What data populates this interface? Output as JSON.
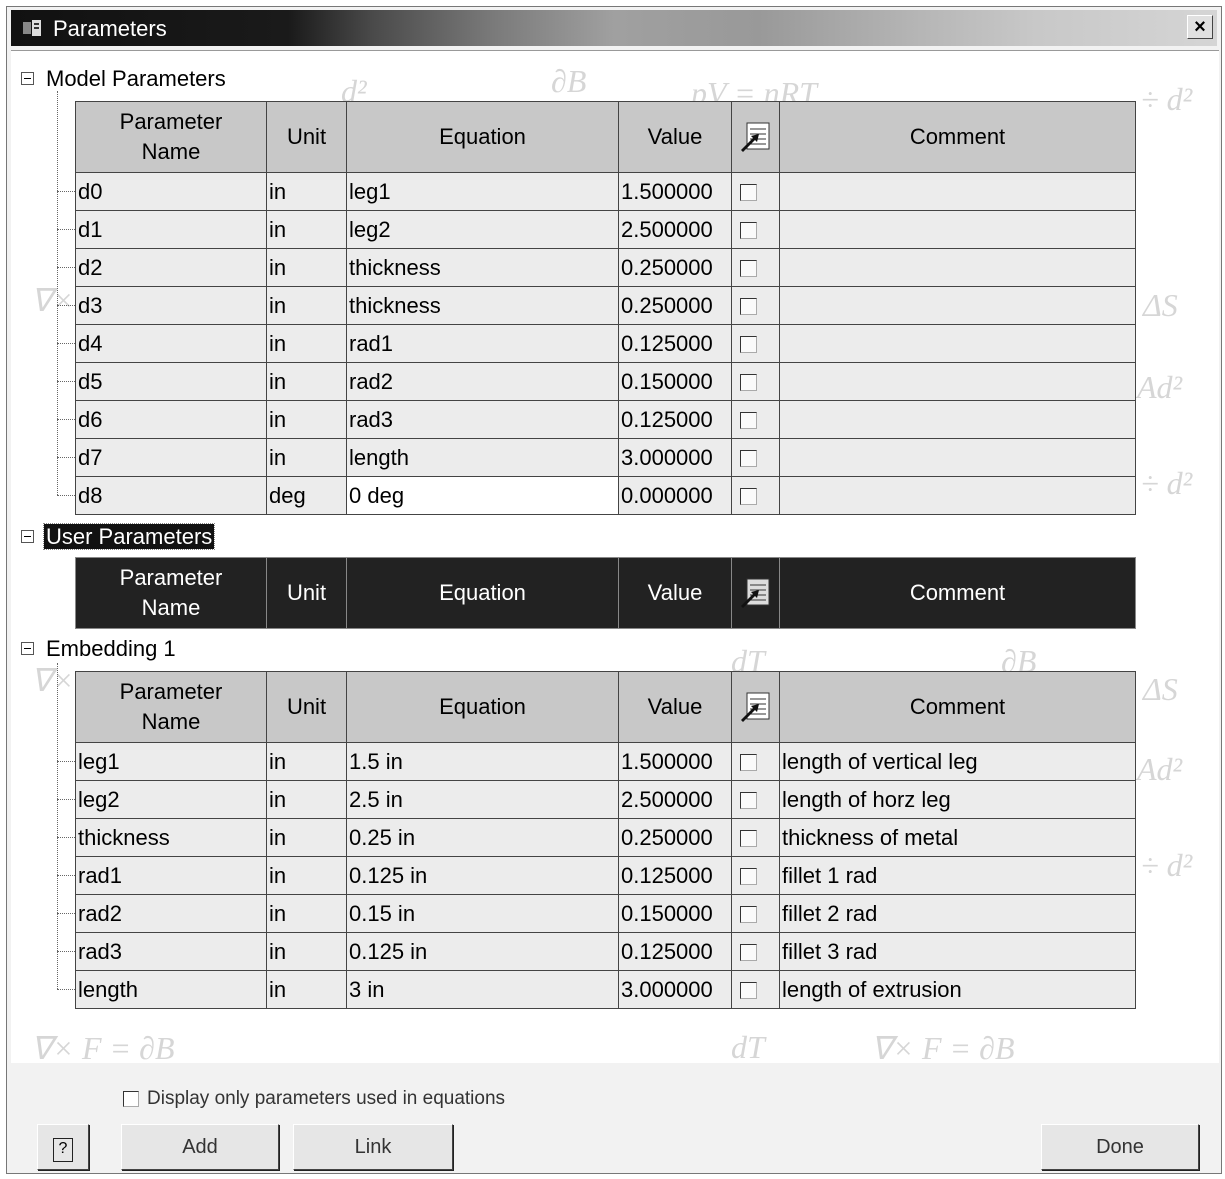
{
  "window": {
    "title": "Parameters",
    "close": "×"
  },
  "columns": {
    "name_l1": "Parameter",
    "name_l2": "Name",
    "unit": "Unit",
    "equation": "Equation",
    "value": "Value",
    "comment": "Comment",
    "toggle_icon": "table-export-icon"
  },
  "model": {
    "title": "Model Parameters",
    "rows": [
      {
        "name": "d0",
        "unit": "in",
        "equation": "leg1",
        "value": "1.500000",
        "comment": ""
      },
      {
        "name": "d1",
        "unit": "in",
        "equation": "leg2",
        "value": "2.500000",
        "comment": ""
      },
      {
        "name": "d2",
        "unit": "in",
        "equation": "thickness",
        "value": "0.250000",
        "comment": ""
      },
      {
        "name": "d3",
        "unit": "in",
        "equation": "thickness",
        "value": "0.250000",
        "comment": ""
      },
      {
        "name": "d4",
        "unit": "in",
        "equation": "rad1",
        "value": "0.125000",
        "comment": ""
      },
      {
        "name": "d5",
        "unit": "in",
        "equation": "rad2",
        "value": "0.150000",
        "comment": ""
      },
      {
        "name": "d6",
        "unit": "in",
        "equation": "rad3",
        "value": "0.125000",
        "comment": ""
      },
      {
        "name": "d7",
        "unit": "in",
        "equation": "length",
        "value": "3.000000",
        "comment": ""
      },
      {
        "name": "d8",
        "unit": "deg",
        "equation": "0 deg",
        "value": "0.000000",
        "comment": ""
      }
    ]
  },
  "user": {
    "title": "User Parameters",
    "rows": []
  },
  "embedding": {
    "title": "Embedding 1",
    "rows": [
      {
        "name": "leg1",
        "unit": "in",
        "equation": "1.5 in",
        "value": "1.500000",
        "comment": "length of vertical leg"
      },
      {
        "name": "leg2",
        "unit": "in",
        "equation": "2.5 in",
        "value": "2.500000",
        "comment": "length of horz leg"
      },
      {
        "name": "thickness",
        "unit": "in",
        "equation": "0.25 in",
        "value": "0.250000",
        "comment": "thickness of metal"
      },
      {
        "name": "rad1",
        "unit": "in",
        "equation": "0.125 in",
        "value": "0.125000",
        "comment": "fillet 1 rad"
      },
      {
        "name": "rad2",
        "unit": "in",
        "equation": "0.15 in",
        "value": "0.150000",
        "comment": "fillet 2 rad"
      },
      {
        "name": "rad3",
        "unit": "in",
        "equation": "0.125 in",
        "value": "0.125000",
        "comment": "fillet 3 rad"
      },
      {
        "name": "length",
        "unit": "in",
        "equation": "3 in",
        "value": "3.000000",
        "comment": "length of extrusion"
      }
    ]
  },
  "footer": {
    "display_only_label": "Display only parameters used in equations",
    "help_label": "?",
    "add_label": "Add",
    "link_label": "Link",
    "done_label": "Done"
  }
}
